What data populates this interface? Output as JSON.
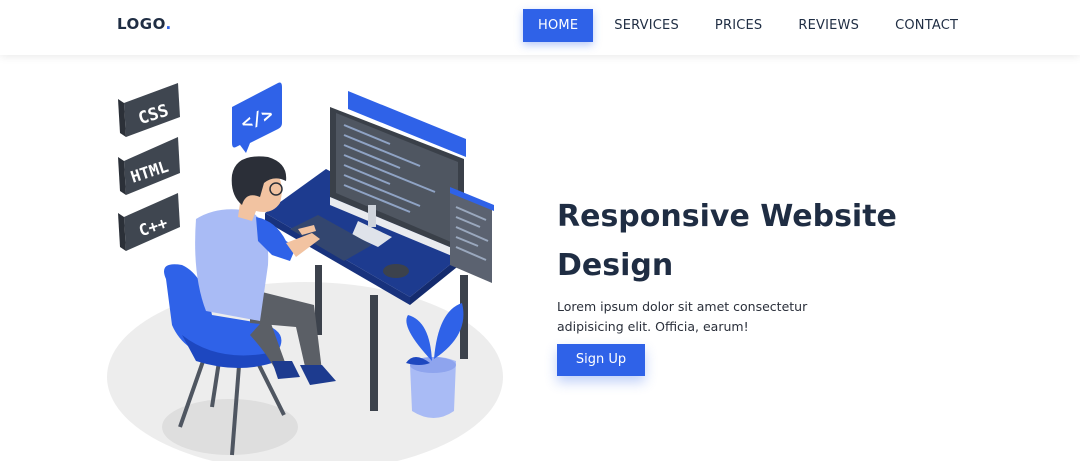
{
  "header": {
    "logo_text": "LOGO",
    "logo_dot": ".",
    "nav": [
      {
        "label": "HOME",
        "active": true
      },
      {
        "label": "SERVICES",
        "active": false
      },
      {
        "label": "PRICES",
        "active": false
      },
      {
        "label": "REVIEWS",
        "active": false
      },
      {
        "label": "CONTACT",
        "active": false
      }
    ]
  },
  "hero": {
    "title_line1": "Responsive Website",
    "title_line2": "Design",
    "description_line1": "Lorem ipsum dolor sit amet consectetur",
    "description_line2": "adipisicing elit. Officia, earum!",
    "cta_label": "Sign Up"
  },
  "illustration": {
    "tag_labels": [
      "CSS",
      "HTML",
      "C++"
    ],
    "code_bubble_text": "</>"
  },
  "colors": {
    "accent": "#2f62e8",
    "heading": "#1f2d43",
    "desk": "#1d3b8f",
    "shirt": "#a9bbf5",
    "pants": "#5b5f66"
  }
}
